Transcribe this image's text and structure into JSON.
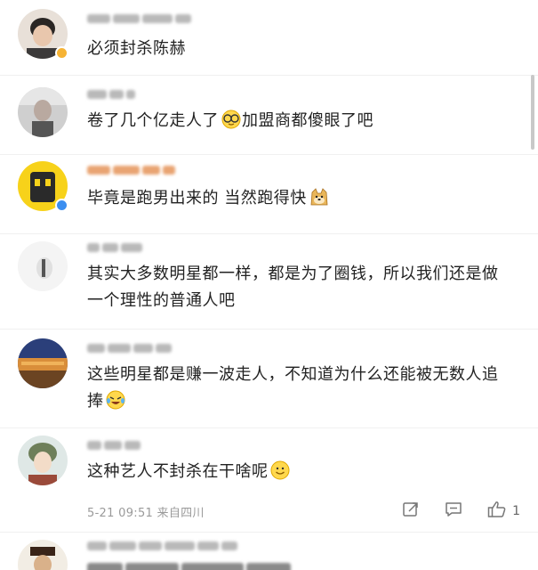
{
  "comments": [
    {
      "text": "必须封杀陈赫"
    },
    {
      "text": "卷了几个亿走人了",
      "text_after": "加盟商都傻眼了吧",
      "emoji": "smiling-face-with-sunglasses-emoji"
    },
    {
      "text": "毕竟是跑男出来的 当然跑得快",
      "emoji": "doge-emoji"
    },
    {
      "text": "其实大多数明星都一样，都是为了圈钱，所以我们还是做一个理性的普通人吧"
    },
    {
      "text": "这些明星都是赚一波走人，不知道为什么还能被无数人追捧",
      "emoji": "laughing-tears-emoji"
    },
    {
      "text": "这种艺人不封杀在干啥呢",
      "emoji": "smiling-face-emoji",
      "timestamp": "5-21 09:51  来自四川",
      "like_count": "1"
    }
  ],
  "icons": {
    "share": "share-icon",
    "reply": "comment-icon",
    "like": "thumbs-up-icon"
  },
  "colors": {
    "text": "#222222",
    "meta": "#9a9a9a",
    "verified_blue": "#3b8ef0",
    "verified_gold": "#f6b334"
  }
}
